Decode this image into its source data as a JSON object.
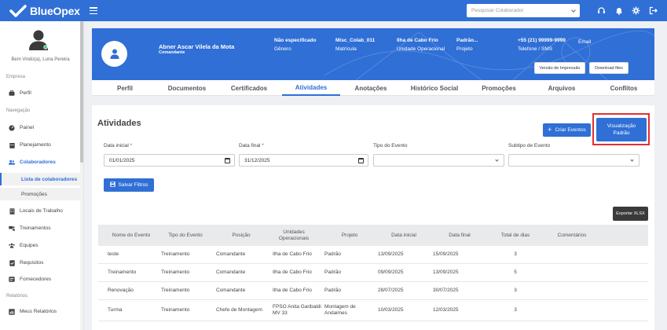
{
  "app": {
    "brand": "BlueOpex"
  },
  "topbar": {
    "search_placeholder": "Pesquisar Colaborador"
  },
  "sidebar": {
    "welcome": "Bem Vindo(a), Luna Pereira",
    "section_empresa": "Empresa",
    "section_navegacao": "Navegação",
    "section_relatorios": "Relatórios",
    "items": {
      "perfil": "Perfil",
      "painel": "Painel",
      "planejamento": "Planejamento",
      "colaboradores": "Colaboradores",
      "lista": "Lista de colaboradores",
      "promocoes": "Promoções",
      "locais": "Locais de Trabalho",
      "treinamentos": "Treinamentos",
      "equipes": "Equipes",
      "requisitos": "Requisitos",
      "fornecedores": "Fornecedores",
      "meus_relatorios": "Meus Relatórios"
    }
  },
  "profile": {
    "name": "Abner Ascar Vilela da Mota",
    "role": "Comandante",
    "genero_value": "Não especificado",
    "genero_label": "Gênero",
    "matricula_value": "Misc_Colab_011",
    "matricula_label": "Matrícula",
    "unidade_value": "Ilha de Cabo Frio",
    "unidade_label": "Unidade Operacional",
    "projeto_value": "Padrão...",
    "projeto_label": "Projeto",
    "telefone_value": "+55 (21) 99999-9999",
    "telefone_label": "Telefone / SMS",
    "email_label": "Email",
    "btn_print": "Versão de Impressão",
    "btn_download": "Download files"
  },
  "tabs": [
    "Perfil",
    "Documentos",
    "Certificados",
    "Atividades",
    "Anotações",
    "Histórico Social",
    "Promoções",
    "Arquivos",
    "Conflitos"
  ],
  "activities": {
    "title": "Atividades",
    "btn_create": "Criar Eventos",
    "btn_view_line1": "Visualização",
    "btn_view_line2": "Padrão",
    "label_start": "Data inicial",
    "label_end": "Data final",
    "label_type": "Tipo do Evento",
    "label_subtype": "Subtipo de Evento",
    "value_start": "01/01/2025",
    "value_end": "31/12/2025",
    "btn_save": "Salvar Filtros",
    "btn_export": "Exportar XLSX",
    "columns": [
      "Nome do Evento",
      "Tipo do Evento",
      "Posição",
      "Unidades Operacionais",
      "Projeto",
      "Data inicial",
      "Data final",
      "Total de dias",
      "Comentários"
    ],
    "rows": [
      [
        "teste",
        "Treinamento",
        "Comandante",
        "Ilha de Cabo Frio",
        "Padrão",
        "13/09/2025",
        "15/09/2025",
        "3",
        ""
      ],
      [
        "Treinamento",
        "Treinamento",
        "Comandante",
        "Ilha de Cabo Frio",
        "Padrão",
        "09/09/2025",
        "13/09/2025",
        "5",
        ""
      ],
      [
        "Renovação",
        "Treinamento",
        "Comandante",
        "Ilha de Cabo Frio",
        "Padrão",
        "28/07/2025",
        "30/07/2025",
        "3",
        ""
      ],
      [
        "Turma",
        "Treinamento",
        "Chefe de Montagem",
        "FPSO Anita Garibaldi MV 33",
        "Montagem de Andaimes",
        "10/03/2025",
        "12/03/2025",
        "3",
        ""
      ]
    ]
  },
  "colors": {
    "primary": "#2f6fd6",
    "highlight": "#e23030",
    "dark": "#3a3a3a"
  }
}
